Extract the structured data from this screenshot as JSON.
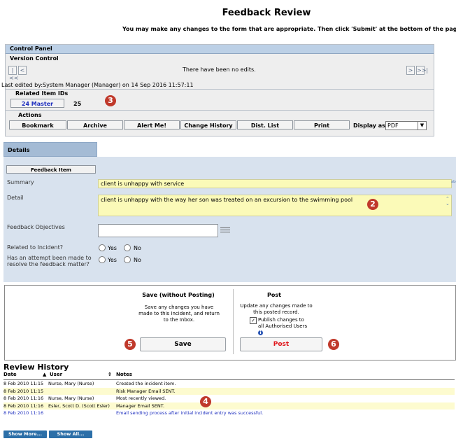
{
  "page": {
    "title": "Feedback Review",
    "subtitle": "You may make any changes to the form that are appropriate. Then click 'Submit' at the bottom of the page."
  },
  "control_panel": {
    "header": "Control Panel",
    "version_control_label": "Version Control",
    "no_edits_text": "There have been no edits.",
    "last_edited": "Last edited by:System Manager (Manager) on 14 Sep 2016 11:57:11",
    "related_label": "Related Item IDs",
    "related_link": "24 Master",
    "related_other": "25",
    "actions_label": "Actions",
    "actions": [
      "Bookmark",
      "Archive",
      "Alert Me!",
      "Change History",
      "Dist. List",
      "Print"
    ],
    "display_as_label": "Display as:",
    "display_as_value": "PDF",
    "nav": {
      "first": "|<<",
      "prev": "<",
      "next": ">",
      "last": ">>|"
    }
  },
  "details": {
    "tab_label": "Details",
    "section_button": "Feedback Item",
    "summary_label": "Summary",
    "summary_value": "client is unhappy with service",
    "detail_label": "Detail",
    "detail_value": "client is unhappy with the way her son was treated on an excursion to the swimming pool",
    "objectives_label": "Feedback Objectives",
    "incident_label": "Related to Incident?",
    "attempt_label": "Has an attempt been made to resolve the feedback matter?",
    "yes": "Yes",
    "no": "No",
    "spell_label": "abc"
  },
  "save_section": {
    "title": "Save (without Posting)",
    "desc": "Save any changes you have made to this Incident, and return to the Inbox.",
    "button": "Save"
  },
  "post_section": {
    "title": "Post",
    "desc": "Update any changes made to this posted record.",
    "checkbox_label": "Publish changes to all Authorised Users",
    "info_icon": "i",
    "button": "Post"
  },
  "badges": {
    "b3": "3",
    "b2": "2",
    "b5": "5",
    "b6": "6",
    "b4": "4"
  },
  "review_history": {
    "title": "Review History",
    "headers": {
      "date": "Date",
      "sort_asc": "▲",
      "user": "User",
      "sort_both": "⇕",
      "notes": "Notes"
    },
    "rows": [
      {
        "date": "8 Feb 2010 11:15",
        "user": "Nurse, Mary (Nurse)",
        "notes": "Created the incident item."
      },
      {
        "date": "8 Feb 2010 11:15",
        "user": "",
        "notes": "Risk Manager Email SENT."
      },
      {
        "date": "8 Feb 2010 11:16",
        "user": "Nurse, Mary (Nurse)",
        "notes": "Most recently viewed."
      },
      {
        "date": "8 Feb 2010 11:16",
        "user": "Esler, Scott D. (Scott Esler)",
        "notes": "Manager Email SENT."
      },
      {
        "date": "8 Feb 2010 11:16",
        "user": "",
        "notes": "Email sending process after initial incident entry was successful."
      }
    ],
    "show_more": "Show More...",
    "show_all": "Show All..."
  },
  "colors": {
    "badge": "#c0392b",
    "link_blue": "#1e2fbf",
    "post_red": "#e0161b",
    "yellow": "#fbfab8",
    "panel_blue": "#d8e2ee"
  }
}
